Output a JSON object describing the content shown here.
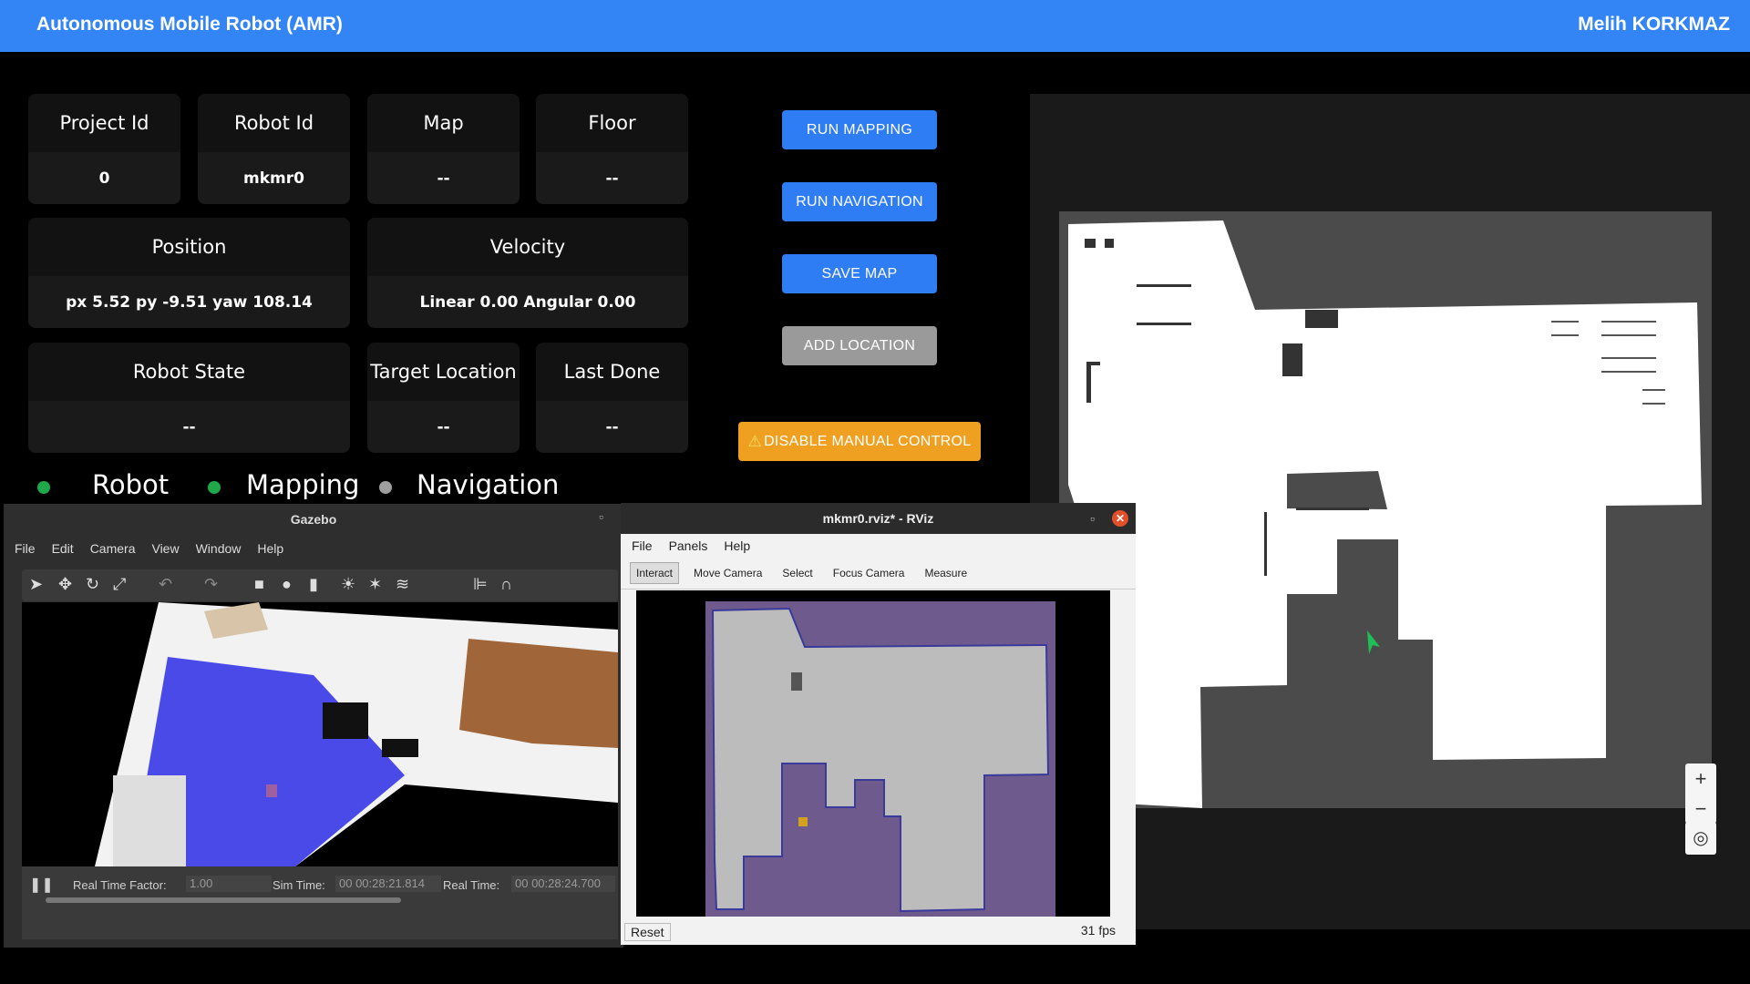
{
  "header": {
    "title": "Autonomous Mobile Robot (AMR)",
    "user": "Melih KORKMAZ",
    "color": "#3384f4"
  },
  "cards": {
    "project_id": {
      "label": "Project Id",
      "value": "0"
    },
    "robot_id": {
      "label": "Robot Id",
      "value": "mkmr0"
    },
    "map": {
      "label": "Map",
      "value": "--"
    },
    "floor": {
      "label": "Floor",
      "value": "--"
    },
    "position": {
      "label": "Position",
      "value": "px 5.52 py -9.51 yaw 108.14"
    },
    "velocity": {
      "label": "Velocity",
      "value": "Linear 0.00 Angular 0.00"
    },
    "robot_state": {
      "label": "Robot State",
      "value": "--"
    },
    "target_location": {
      "label": "Target Location",
      "value": "--"
    },
    "last_done_target": {
      "label": "Last Done Target",
      "value": "--"
    }
  },
  "buttons": {
    "run_mapping": "RUN MAPPING",
    "run_navigation": "RUN NAVIGATION",
    "save_map": "SAVE MAP",
    "add_location": "ADD LOCATION",
    "disable_manual": "DISABLE MANUAL CONTROL"
  },
  "status": [
    {
      "label": "Robot",
      "color": "#1fa84a"
    },
    {
      "label": "Mapping",
      "color": "#1fa84a"
    },
    {
      "label": "Navigation",
      "color": "#9e9e9e"
    }
  ],
  "map": {
    "zoom_in": "+",
    "zoom_out": "−",
    "robot_color": "#1fbf55"
  },
  "gazebo": {
    "title": "Gazebo",
    "menu": [
      "File",
      "Edit",
      "Camera",
      "View",
      "Window",
      "Help"
    ],
    "real_time_factor_label": "Real Time Factor:",
    "real_time_factor": "1.00",
    "sim_time_label": "Sim Time:",
    "sim_time": "00 00:28:21.814",
    "real_time_label": "Real Time:",
    "real_time": "00 00:28:24.700"
  },
  "rviz": {
    "title": "mkmr0.rviz* - RViz",
    "menu": [
      "File",
      "Panels",
      "Help"
    ],
    "tools": [
      "Interact",
      "Move Camera",
      "Select",
      "Focus Camera",
      "Measure"
    ],
    "reset": "Reset",
    "fps": "31 fps"
  }
}
